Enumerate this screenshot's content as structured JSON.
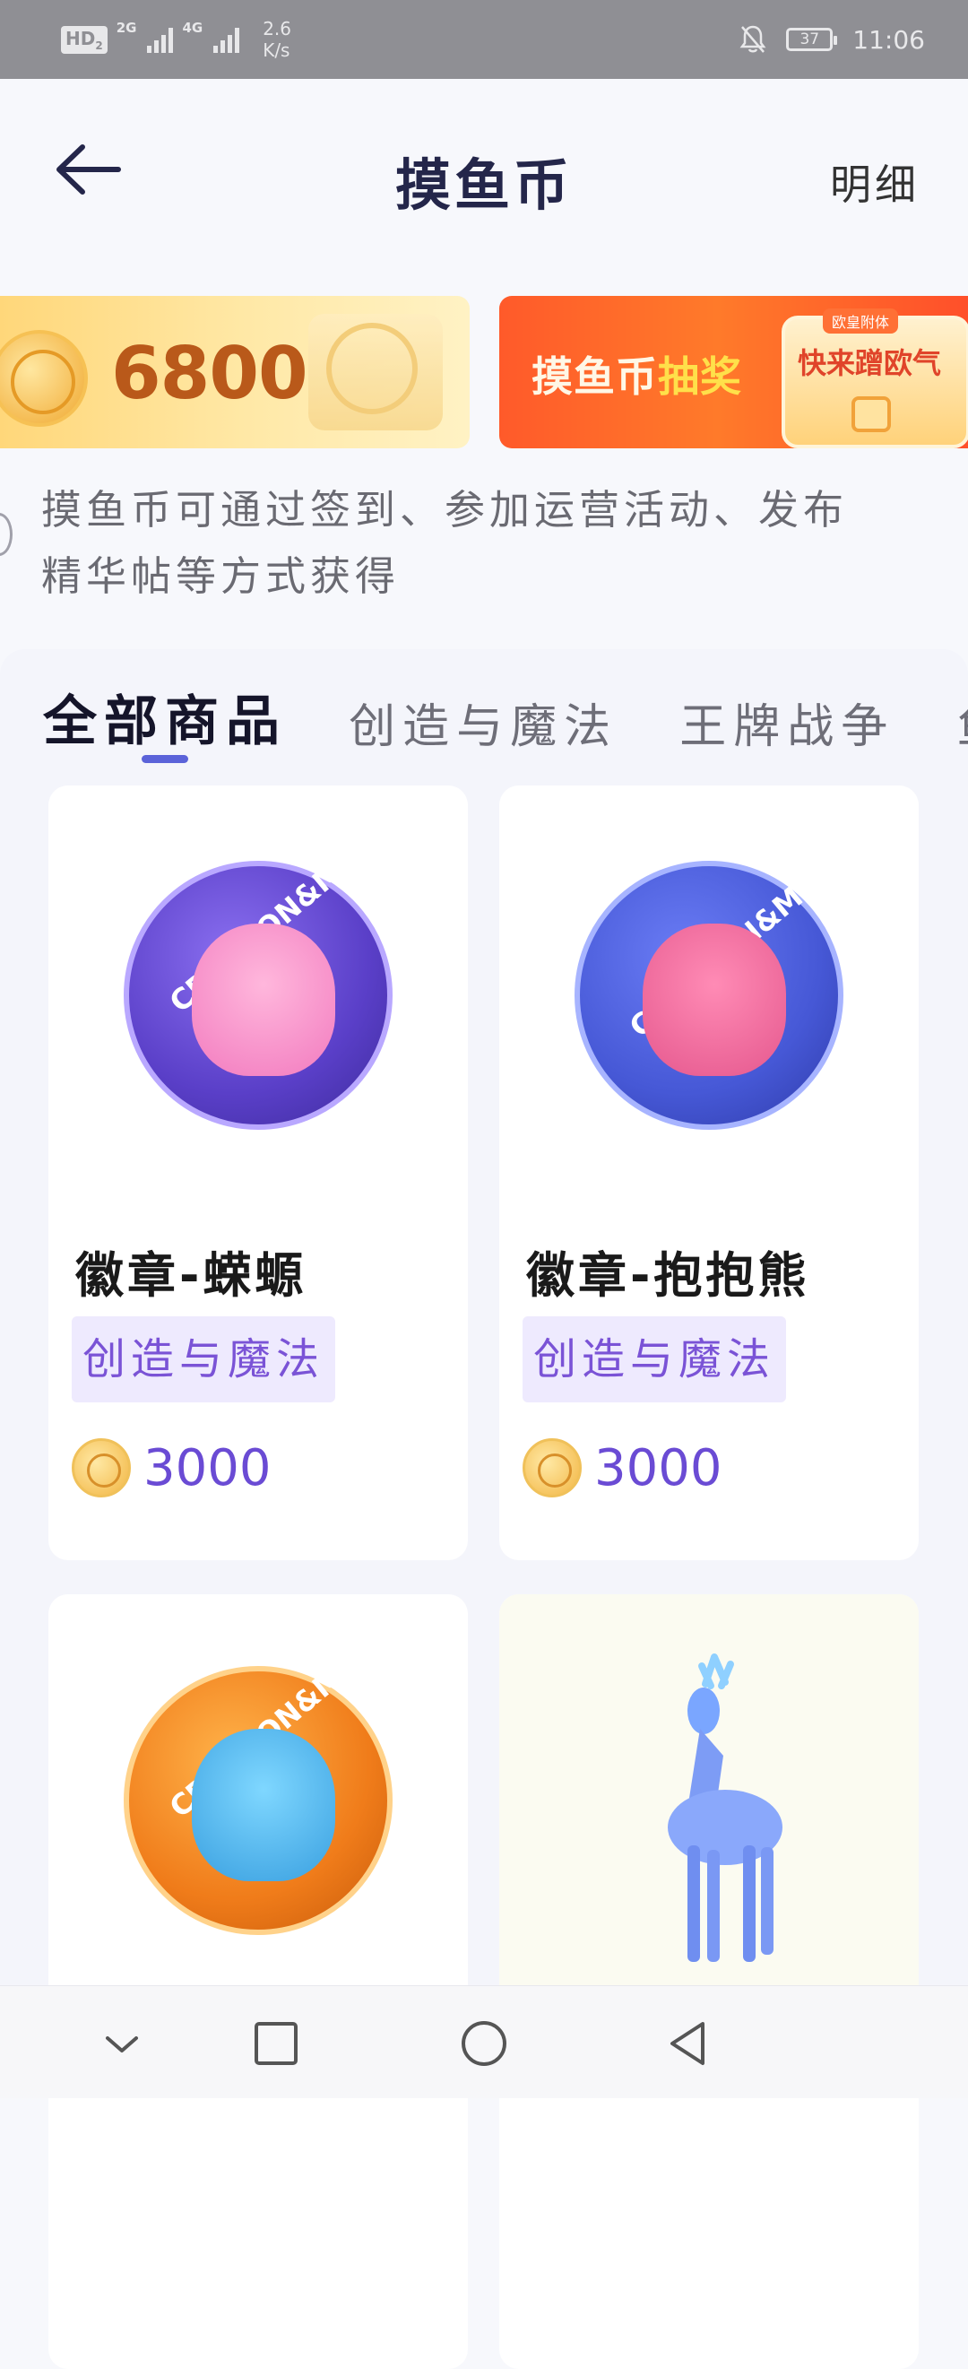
{
  "status_bar": {
    "hd": "HD",
    "hd_sub": "2",
    "sig1_label": "2G",
    "sig2_label": "4G",
    "net_speed_value": "2.6",
    "net_speed_unit": "K/s",
    "battery": "37",
    "time": "11:06"
  },
  "header": {
    "title": "摸鱼币",
    "detail_label": "明细"
  },
  "coins_banner": {
    "balance": "6800"
  },
  "lottery_banner": {
    "label_part1": "摸鱼币",
    "label_part2": "抽奖",
    "card_tag": "欧皇附体",
    "card_title": "快来蹭欧气"
  },
  "info": {
    "line1": "摸鱼币可通过签到、参加运营活动、发布",
    "line2": "精华帖等方式获得"
  },
  "tabs": [
    {
      "label": "全部商品",
      "active": true
    },
    {
      "label": "创造与魔法",
      "active": false
    },
    {
      "label": "王牌战争",
      "active": false
    },
    {
      "label": "鱼",
      "active": false
    }
  ],
  "products": [
    {
      "name": "徽章-蝾螈",
      "tag": "创造与魔法",
      "price": "3000",
      "badge_text": "CREATION&M"
    },
    {
      "name": "徽章-抱抱熊",
      "tag": "创造与魔法",
      "price": "3000",
      "badge_text": "CREATION&MAGIC"
    },
    {
      "name": "",
      "tag": "",
      "price": "",
      "badge_text": "CREATION&M"
    },
    {
      "name": "",
      "tag": "",
      "price": ""
    }
  ],
  "colors": {
    "accent": "#5b63d9",
    "tag_bg": "#eeeafe",
    "tag_text": "#7a53d6",
    "price_text": "#6a4bd4",
    "balance_text": "#b9591a"
  }
}
